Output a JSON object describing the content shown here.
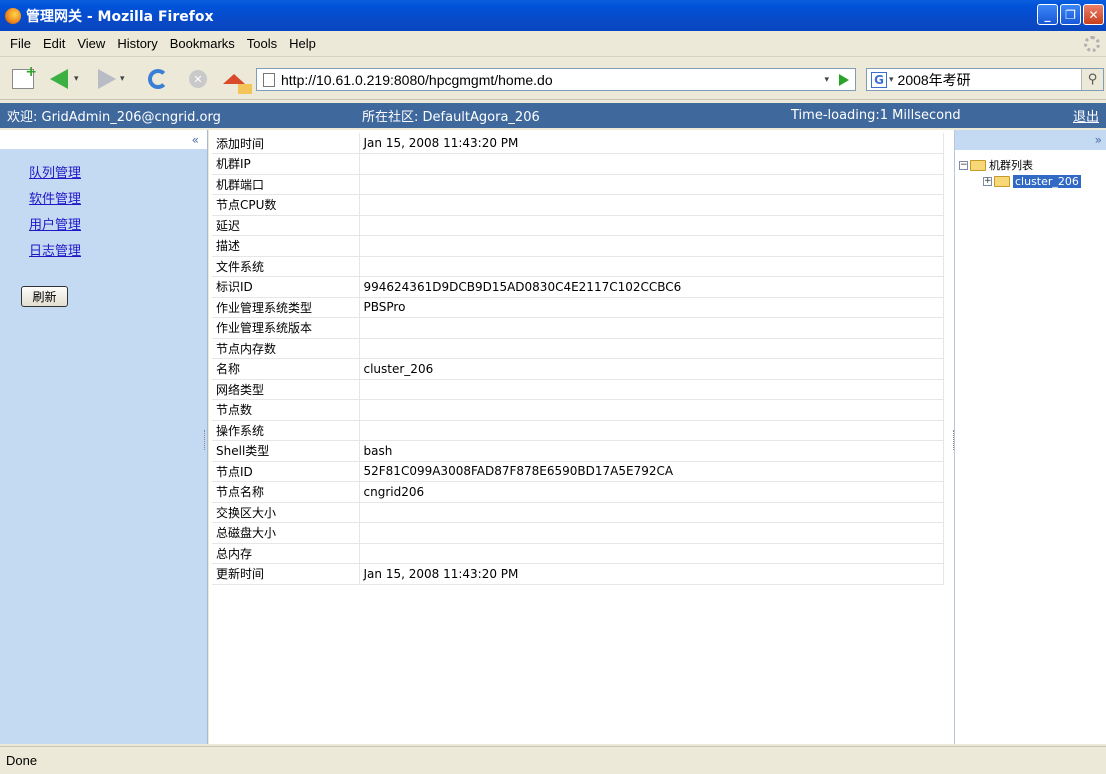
{
  "window": {
    "title": "管理网关 - Mozilla Firefox"
  },
  "menu": {
    "items": [
      "File",
      "Edit",
      "View",
      "History",
      "Bookmarks",
      "Tools",
      "Help"
    ]
  },
  "toolbar": {
    "url": "http://10.61.0.219:8080/hpcgmgmt/home.do",
    "search_engine": "G",
    "search_value": "2008年考研",
    "icons": [
      "new-tab-icon",
      "back-icon",
      "forward-icon",
      "reload-icon",
      "stop-icon",
      "home-icon",
      "go-icon",
      "search-icon"
    ]
  },
  "header": {
    "welcome": "欢迎: GridAdmin_206@cngrid.org",
    "community": "所在社区: DefaultAgora_206",
    "timing": "Time-loading:1 Millsecond",
    "logout": "退出"
  },
  "left_panel": {
    "collapse": "«",
    "nav": [
      "队列管理",
      "软件管理",
      "用户管理",
      "日志管理"
    ],
    "refresh_label": "刷新"
  },
  "properties": [
    {
      "key": "添加时间",
      "value": "Jan 15, 2008 11:43:20 PM"
    },
    {
      "key": "机群IP",
      "value": ""
    },
    {
      "key": "机群端口",
      "value": ""
    },
    {
      "key": "节点CPU数",
      "value": ""
    },
    {
      "key": "延迟",
      "value": ""
    },
    {
      "key": "描述",
      "value": ""
    },
    {
      "key": "文件系统",
      "value": ""
    },
    {
      "key": "标识ID",
      "value": "994624361D9DCB9D15AD0830C4E2117C102CCBC6"
    },
    {
      "key": "作业管理系统类型",
      "value": "PBSPro"
    },
    {
      "key": "作业管理系统版本",
      "value": ""
    },
    {
      "key": "节点内存数",
      "value": ""
    },
    {
      "key": "名称",
      "value": "cluster_206"
    },
    {
      "key": "网络类型",
      "value": ""
    },
    {
      "key": "节点数",
      "value": ""
    },
    {
      "key": "操作系统",
      "value": ""
    },
    {
      "key": "Shell类型",
      "value": "bash"
    },
    {
      "key": "节点ID",
      "value": "52F81C099A3008FAD87F878E6590BD17A5E792CA"
    },
    {
      "key": "节点名称",
      "value": "cngrid206"
    },
    {
      "key": "交换区大小",
      "value": ""
    },
    {
      "key": "总磁盘大小",
      "value": ""
    },
    {
      "key": "总内存",
      "value": ""
    },
    {
      "key": "更新时间",
      "value": "Jan 15, 2008 11:43:20 PM"
    }
  ],
  "right_panel": {
    "expand": "»",
    "tree_root": "机群列表",
    "tree_child": "cluster_206"
  },
  "status": {
    "text": "Done"
  }
}
